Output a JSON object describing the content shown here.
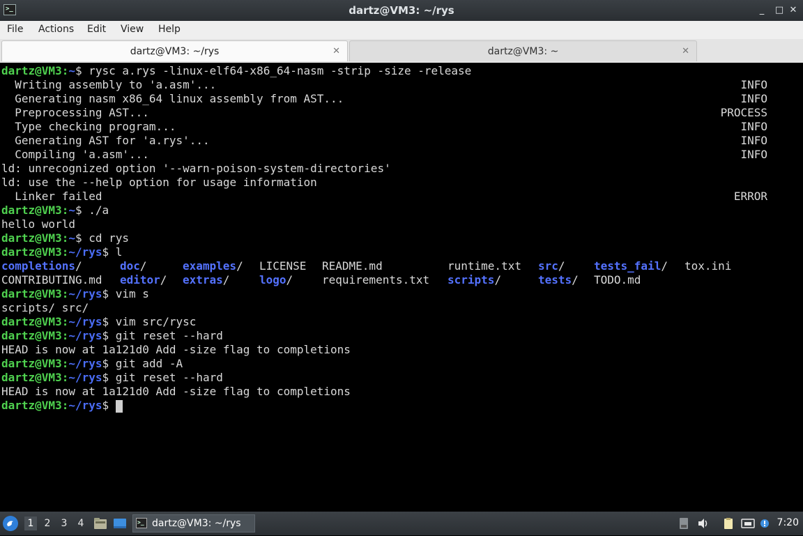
{
  "window": {
    "title": "dartz@VM3: ~/rys",
    "app_icon": ">_",
    "minimize": "_",
    "maximize": "□",
    "close": "✕"
  },
  "menu": [
    "File",
    "Actions",
    "Edit",
    "View",
    "Help"
  ],
  "tabs": [
    {
      "label": "dartz@VM3: ~/rys",
      "active": true,
      "close": "✕"
    },
    {
      "label": "dartz@VM3: ~",
      "active": false,
      "close": "✕"
    }
  ],
  "terminal": {
    "lines": [
      {
        "prompt": "dartz@VM3:",
        "path": "~",
        "sym": "$",
        "cmd": " rysc a.rys -linux-elf64-x86_64-nasm -strip -size -release"
      },
      {
        "text": "  Writing assembly to 'a.asm'...",
        "status": "INFO"
      },
      {
        "text": "  Generating nasm x86_64 linux assembly from AST...",
        "status": "INFO"
      },
      {
        "text": "  Preprocessing AST...",
        "status": "PROCESS"
      },
      {
        "text": "  Type checking program...",
        "status": "INFO"
      },
      {
        "text": "  Generating AST for 'a.rys'...",
        "status": "INFO"
      },
      {
        "text": "  Compiling 'a.asm'...",
        "status": "INFO"
      },
      {
        "text": "ld: unrecognized option '--warn-poison-system-directories'"
      },
      {
        "text": "ld: use the --help option for usage information"
      },
      {
        "text": "  Linker failed",
        "status": "ERROR"
      },
      {
        "prompt": "dartz@VM3:",
        "path": "~",
        "sym": "$",
        "cmd": " ./a"
      },
      {
        "text": "hello world"
      },
      {
        "prompt": "dartz@VM3:",
        "path": "~",
        "sym": "$",
        "cmd": " cd rys"
      },
      {
        "prompt": "dartz@VM3:",
        "path": "~/rys",
        "sym": "$",
        "cmd": " l"
      },
      {
        "ls": [
          {
            "name": "completions",
            "suffix": "/",
            "dir": true
          },
          {
            "name": "doc",
            "suffix": "/",
            "dir": true
          },
          {
            "name": "examples",
            "suffix": "/",
            "dir": true
          },
          {
            "name": "LICENSE",
            "suffix": "",
            "dir": false
          },
          {
            "name": "README.md",
            "suffix": "",
            "dir": false
          },
          {
            "name": "runtime.txt",
            "suffix": "",
            "dir": false
          },
          {
            "name": "src",
            "suffix": "/",
            "dir": true
          },
          {
            "name": "tests_fail",
            "suffix": "/",
            "dir": true
          },
          {
            "name": "tox.ini",
            "suffix": "",
            "dir": false
          }
        ]
      },
      {
        "ls": [
          {
            "name": "CONTRIBUTING.md",
            "suffix": "",
            "dir": false
          },
          {
            "name": "editor",
            "suffix": "/",
            "dir": true
          },
          {
            "name": "extras",
            "suffix": "/",
            "dir": true
          },
          {
            "name": "logo",
            "suffix": "/",
            "dir": true
          },
          {
            "name": "requirements.txt",
            "suffix": "",
            "dir": false
          },
          {
            "name": "scripts",
            "suffix": "/",
            "dir": true
          },
          {
            "name": "tests",
            "suffix": "/",
            "dir": true
          },
          {
            "name": "TODO.md",
            "suffix": "",
            "dir": false
          }
        ]
      },
      {
        "prompt": "dartz@VM3:",
        "path": "~/rys",
        "sym": "$",
        "cmd": " vim s"
      },
      {
        "text": "scripts/ src/"
      },
      {
        "prompt": "dartz@VM3:",
        "path": "~/rys",
        "sym": "$",
        "cmd": " vim src/rysc"
      },
      {
        "prompt": "dartz@VM3:",
        "path": "~/rys",
        "sym": "$",
        "cmd": " git reset --hard"
      },
      {
        "text": "HEAD is now at 1a121d0 Add -size flag to completions"
      },
      {
        "prompt": "dartz@VM3:",
        "path": "~/rys",
        "sym": "$",
        "cmd": " git add -A"
      },
      {
        "prompt": "dartz@VM3:",
        "path": "~/rys",
        "sym": "$",
        "cmd": " git reset --hard"
      },
      {
        "text": "HEAD is now at 1a121d0 Add -size flag to completions"
      },
      {
        "prompt": "dartz@VM3:",
        "path": "~/rys",
        "sym": "$",
        "cmd": " ",
        "cursor": true
      }
    ]
  },
  "taskbar": {
    "start_icon": "whisker-menu-icon",
    "workspaces": [
      "1",
      "2",
      "3",
      "4"
    ],
    "active_workspace": "1",
    "task_label": "dartz@VM3: ~/rys",
    "task_icon": ">_",
    "tray_icons": [
      "removable-drive-icon",
      "volume-icon",
      "clipboard-icon",
      "network-icon",
      "notification-icon"
    ],
    "clock": "7:20"
  },
  "colors": {
    "prompt": "#4fd14f",
    "path": "#4a6cf4",
    "directory": "#5472ff",
    "terminal_bg": "#000000",
    "terminal_fg": "#d9d9d9"
  }
}
